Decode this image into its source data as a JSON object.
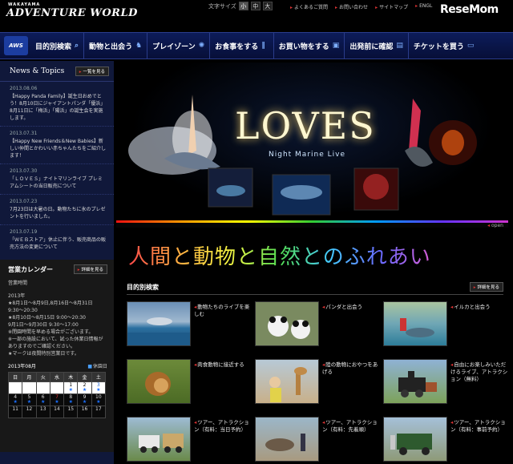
{
  "header": {
    "logo_small": "WAKAYAMA",
    "logo_main": "ADVENTURE WORLD",
    "fontsize_label": "文字サイズ",
    "fontsize_options": [
      "小",
      "中",
      "大"
    ],
    "links": [
      "よくあるご質問",
      "お問い合わせ",
      "サイトマップ",
      "ENGL"
    ],
    "brand": "ReseMom"
  },
  "nav": {
    "logo": "AWS",
    "items": [
      "目的別検索",
      "動物と出会う",
      "プレイゾーン",
      "お食事をする",
      "お買い物をする",
      "出発前に確認",
      "チケットを買う"
    ]
  },
  "news": {
    "title": "News & Topics",
    "list_button": "一覧を見る",
    "items": [
      {
        "date": "2013.08.06",
        "text": "【Happy Panda Family】誕生日おめでとう！8月10日にジャイアントパンダ「優浜」8月11日に「梅浜」「陽浜」の誕生会を実施します。"
      },
      {
        "date": "2013.07.31",
        "text": "【Happy New Friends＆New Babies】新しい仲間とかわいい赤ちゃんたちをご紹介します！"
      },
      {
        "date": "2013.07.30",
        "text": "「ＬＯＶＥＳ」ナイトマリンライブ プレミアムシートの当日販売について"
      },
      {
        "date": "2013.07.23",
        "text": "7月23日は大暑の日。動物たちに氷のプレゼントを行いました。"
      },
      {
        "date": "2013.07.19",
        "text": "「ＷＥＢストア」休止に伴う、販売商品の販売方法の変更について"
      }
    ]
  },
  "calendar": {
    "title": "営業カレンダー",
    "detail_button": "詳細を見る",
    "subtitle": "営業時間",
    "hours": [
      "2013年",
      "★8月1日〜8月9日,8月16日〜8月31日 9:30〜20:30",
      "★8月10日〜8月15日 9:00〜20:30",
      "9月1日〜9月30日 9:30〜17:00",
      "※閉園時間を早める場合がございます。",
      "※一部の施設において、試った休業日情報がありますのでご確認ください。",
      "★マークは夜間特別営業日です。"
    ],
    "month": "2013年08月",
    "legend": "休園日",
    "weekdays": [
      "日",
      "月",
      "火",
      "水",
      "木",
      "金",
      "土"
    ],
    "rows": [
      [
        "",
        "",
        "",
        "",
        "1",
        "2",
        "3"
      ],
      [
        "4",
        "5",
        "6",
        "7",
        "8",
        "9",
        "10"
      ],
      [
        "11",
        "12",
        "13",
        "14",
        "15",
        "16",
        "17"
      ]
    ]
  },
  "hero": {
    "title": "LOVES",
    "subtitle": "Night Marine Live",
    "open_label": "open"
  },
  "main": {
    "tagline": "人間と動物と自然とのふれあい",
    "section_title": "目的別検索",
    "detail_button": "詳細を見る",
    "cards": [
      {
        "label": "動物たちのライブを楽しむ",
        "thumb": "dolphin-show"
      },
      {
        "label": "パンダと出会う",
        "thumb": "panda"
      },
      {
        "label": "イルカと出会う",
        "thumb": "dolphin-pool"
      },
      {
        "label": "肉食動物に接近する",
        "thumb": "lion"
      },
      {
        "label": "陸の動物におやつをあげる",
        "thumb": "giraffe-feeding"
      },
      {
        "label": "自由にお楽しみいただけるライブ、アトラクション（無料）",
        "thumb": "train"
      },
      {
        "label": "ツアー、アトラクション（有料：当日予約）",
        "thumb": "safari-tour"
      },
      {
        "label": "ツアー、アトラクション（有料：先着順）",
        "thumb": "sea-lion"
      },
      {
        "label": "ツアー、アトラクション（有料：事前予約）",
        "thumb": "bus-tour"
      }
    ]
  }
}
